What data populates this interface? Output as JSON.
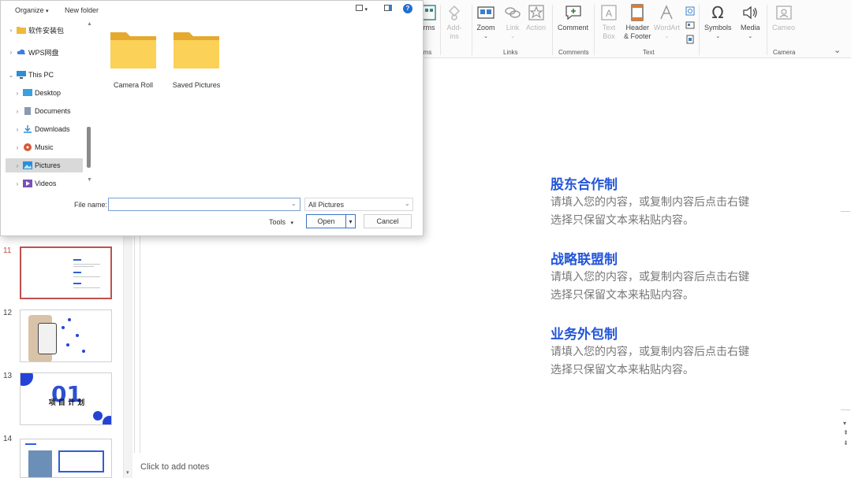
{
  "dialog": {
    "toolbar": {
      "organize": "Organize",
      "new_folder": "New folder"
    },
    "nav_items": [
      {
        "label": "软件安装包",
        "icon": "folder-icon",
        "chevron": "›"
      },
      {
        "label": "WPS网盘",
        "icon": "cloud-icon",
        "chevron": "›"
      },
      {
        "label": "This PC",
        "icon": "computer-icon",
        "chevron": "⌄"
      },
      {
        "label": "Desktop",
        "icon": "desktop-icon",
        "chevron": "›"
      },
      {
        "label": "Documents",
        "icon": "documents-icon",
        "chevron": "›"
      },
      {
        "label": "Downloads",
        "icon": "downloads-icon",
        "chevron": "›"
      },
      {
        "label": "Music",
        "icon": "music-icon",
        "chevron": "›"
      },
      {
        "label": "Pictures",
        "icon": "pictures-icon",
        "chevron": "›"
      },
      {
        "label": "Videos",
        "icon": "videos-icon",
        "chevron": "›"
      }
    ],
    "folders": [
      {
        "label": "Camera Roll"
      },
      {
        "label": "Saved Pictures"
      }
    ],
    "file_name_label": "File name:",
    "file_name_value": "",
    "file_type": "All Pictures",
    "tools_label": "Tools",
    "open_label": "Open",
    "cancel_label": "Cancel"
  },
  "ribbon": {
    "buttons": {
      "forms": "rms",
      "addins": "Add-\nins",
      "zoom": "Zoom",
      "link": "Link",
      "action": "Action",
      "comment": "Comment",
      "textbox": "Text\nBox",
      "header_footer": "Header\n& Footer",
      "wordart": "WordArt",
      "symbols": "Symbols",
      "media": "Media",
      "cameo": "Cameo"
    },
    "groups": {
      "forms_group": "rms",
      "links": "Links",
      "comments": "Comments",
      "text": "Text",
      "camera": "Camera"
    }
  },
  "thumbnails": [
    {
      "number": "11",
      "selected": true
    },
    {
      "number": "12",
      "selected": false
    },
    {
      "number": "13",
      "selected": false,
      "big_text": "01",
      "caption": "项 目 计 划"
    },
    {
      "number": "14",
      "selected": false
    }
  ],
  "slide": {
    "sections": [
      {
        "title": "股东合作制",
        "body1": "请填入您的内容，或复制内容后点击右键",
        "body2": "选择只保留文本来粘贴内容。"
      },
      {
        "title": "战略联盟制",
        "body1": "请填入您的内容，或复制内容后点击右键",
        "body2": "选择只保留文本来粘贴内容。"
      },
      {
        "title": "业务外包制",
        "body1": "请填入您的内容，或复制内容后点击右键",
        "body2": "选择只保留文本来粘贴内容。"
      }
    ]
  },
  "notes_placeholder": "Click to add notes",
  "colors": {
    "accent_blue": "#2356d8",
    "selected_thumb": "#c0504d",
    "folder_yellow": "#f7c948"
  }
}
